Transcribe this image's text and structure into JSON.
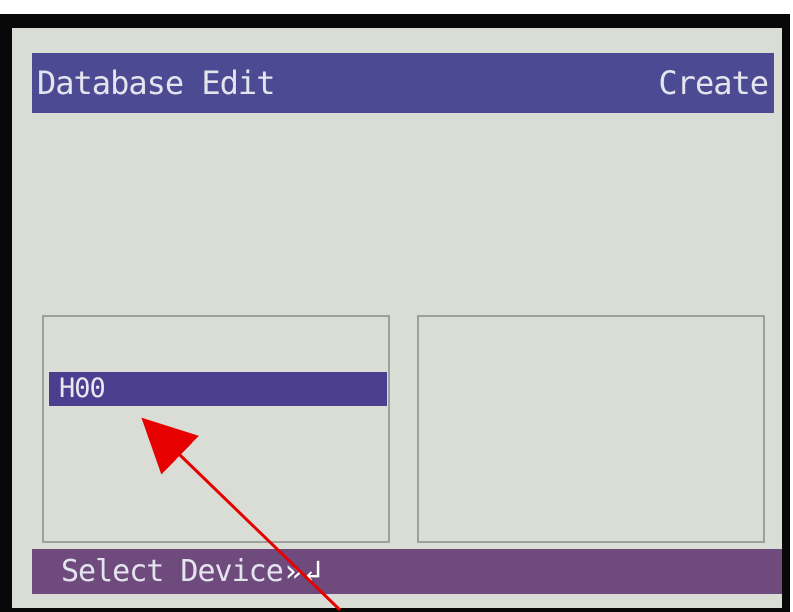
{
  "screen": {
    "title_left": "Database Edit",
    "title_right": "Create",
    "device_list": {
      "items": [
        {
          "label": "H00",
          "selected": true
        }
      ]
    },
    "status": {
      "text": "Select Device",
      "arrow_glyph": "»",
      "corner_glyph": "↲"
    }
  },
  "colors": {
    "title_bar": "#4b4a93",
    "screen": "#d9ddd5",
    "selection": "#4b3e8f",
    "status_bar": "#6f4a7d",
    "annotation_arrow": "#e60000"
  },
  "annotation": {
    "icon": "red-arrow-icon"
  }
}
